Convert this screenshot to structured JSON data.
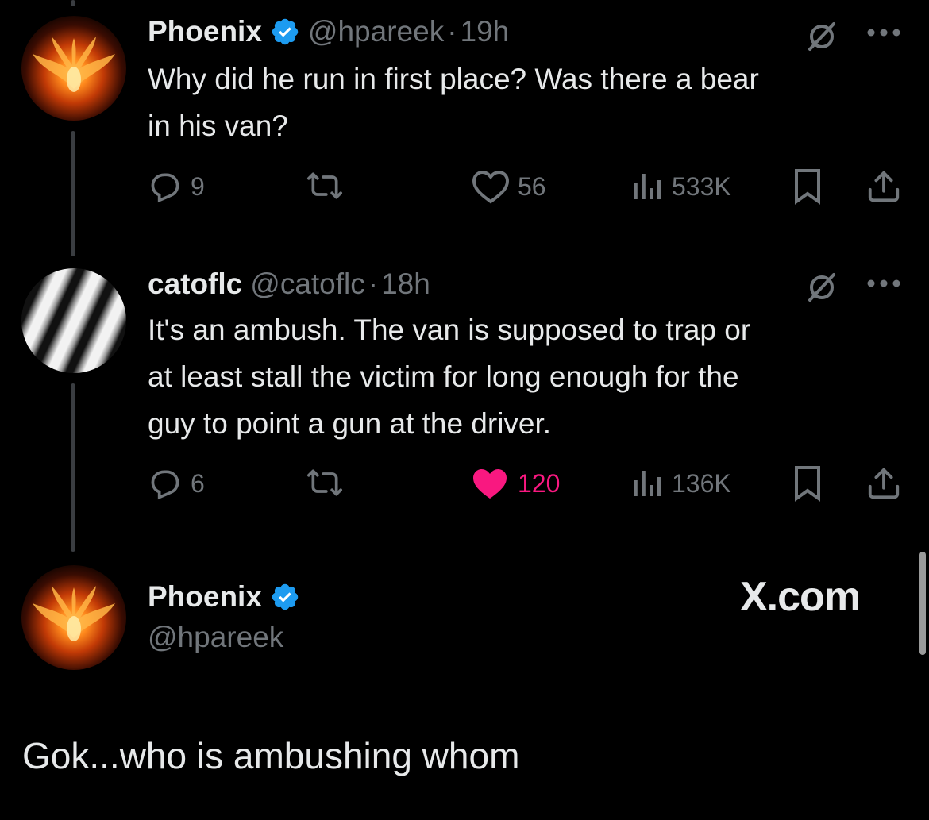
{
  "tweets": [
    {
      "name": "Phoenix",
      "handle": "@hpareek",
      "sep": "·",
      "time": "19h",
      "text_line1": "Why did he run in first place? Was there a bear",
      "text_line2": "in his van?",
      "replies": "9",
      "likes": "56",
      "views": "533K",
      "liked": false
    },
    {
      "name": "catoflc",
      "handle": "@catoflc",
      "sep": "·",
      "time": "18h",
      "text_line1": "It's an ambush. The van is supposed to trap or",
      "text_line2": "at least stall the victim for long enough for the",
      "text_line3": "guy to point a gun at the driver.",
      "replies": "6",
      "likes": "120",
      "views": "136K",
      "liked": true
    }
  ],
  "composer": {
    "name": "Phoenix",
    "handle": "@hpareek",
    "brand": "X.com",
    "reply_text": "Gok...who is ambushing whom"
  },
  "colors": {
    "background": "#000000",
    "text": "#e7e9ea",
    "muted": "#71767b",
    "like": "#f91880",
    "verified": "#1d9bf0"
  },
  "icons": [
    "verified-badge-icon",
    "grok-icon",
    "more-icon",
    "reply-icon",
    "retweet-icon",
    "like-icon",
    "views-icon",
    "bookmark-icon",
    "share-icon"
  ]
}
